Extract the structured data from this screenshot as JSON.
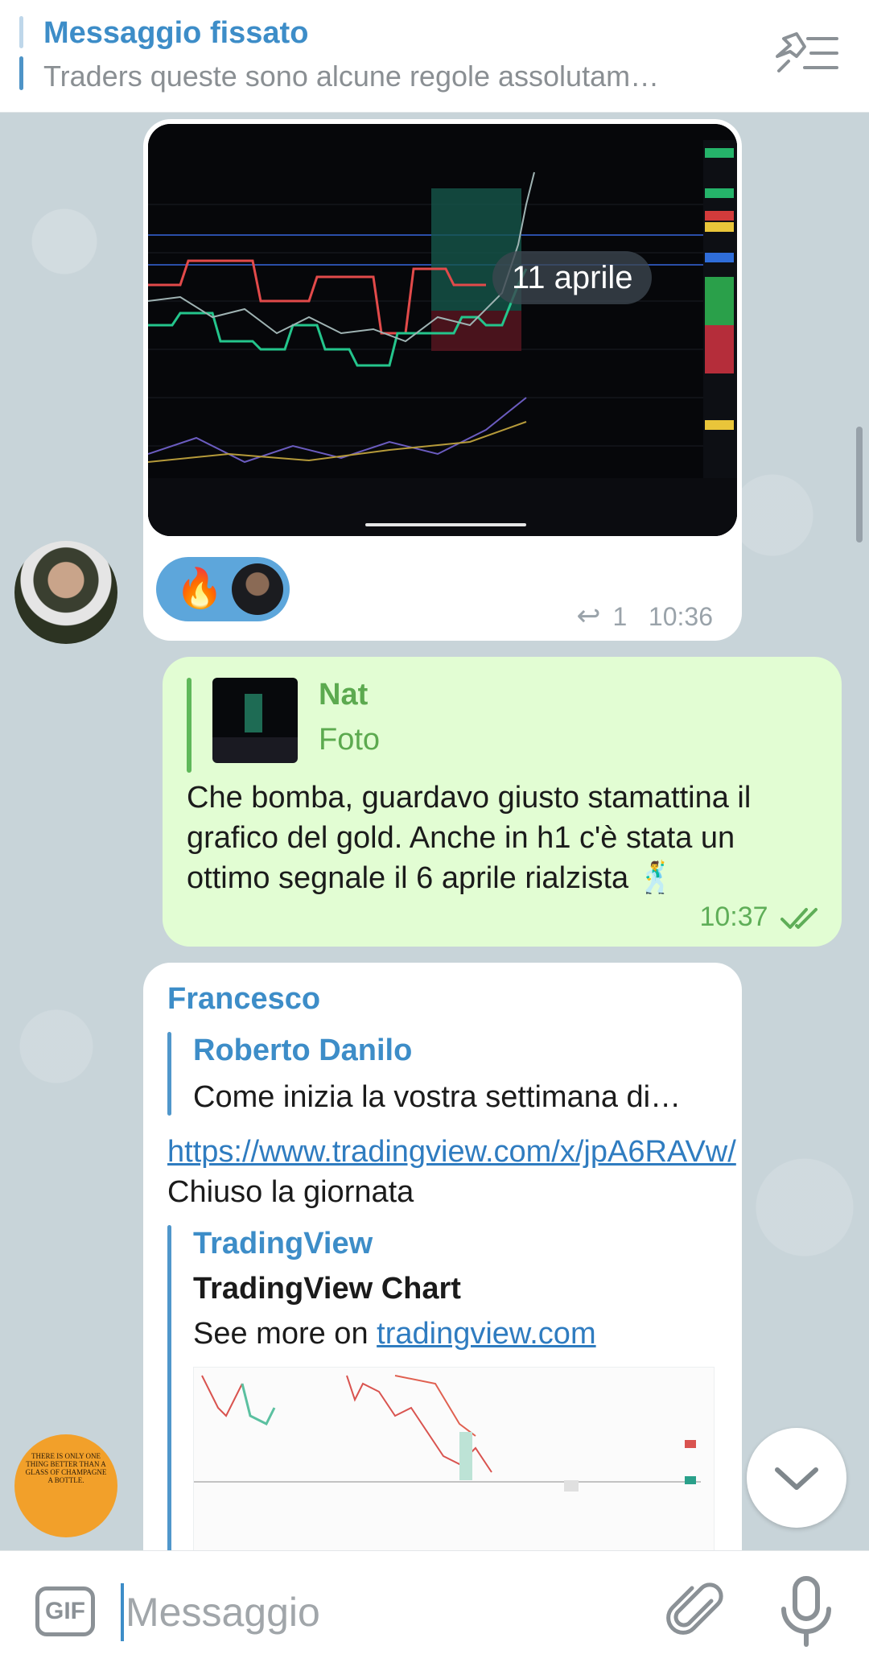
{
  "pinned": {
    "title": "Messaggio fissato",
    "text": "Traders queste sono alcune regole assolutam…",
    "icon": "pin-list-icon"
  },
  "messages": {
    "photo": {
      "date_label": "11 aprile",
      "reaction_emoji": "🔥",
      "reply_count": "1",
      "time": "10:36"
    },
    "outgoing": {
      "quote_name": "Nat",
      "quote_type": "Foto",
      "text": "Che bomba, guardavo giusto stamattina il grafico del gold. Anche in h1 c'è stata un ottimo segnale il 6 aprile rialzista 🕺",
      "time": "10:37",
      "status_icon": "double-check-icon"
    },
    "incoming": {
      "sender": "Francesco",
      "reply_name": "Roberto Danilo",
      "reply_text": "Come inizia la vostra settimana di…",
      "link": "https://www.tradingview.com/x/jpA6RAVw/",
      "text_after_link": " Chiuso la giornata",
      "preview_site": "TradingView",
      "preview_title": "TradingView Chart",
      "preview_desc_prefix": "See more on ",
      "preview_link": "tradingview.com"
    }
  },
  "avatar_champagne_text": "THERE IS ONLY ONE THING BETTER THAN A GLASS OF CHAMPAGNE A BOTTLE.",
  "input": {
    "gif_label": "GIF",
    "placeholder": "Messaggio"
  },
  "colors": {
    "accent": "#3d8dc8",
    "outgoing_bg": "#e2fdd3",
    "outgoing_accent": "#5caa4f"
  }
}
